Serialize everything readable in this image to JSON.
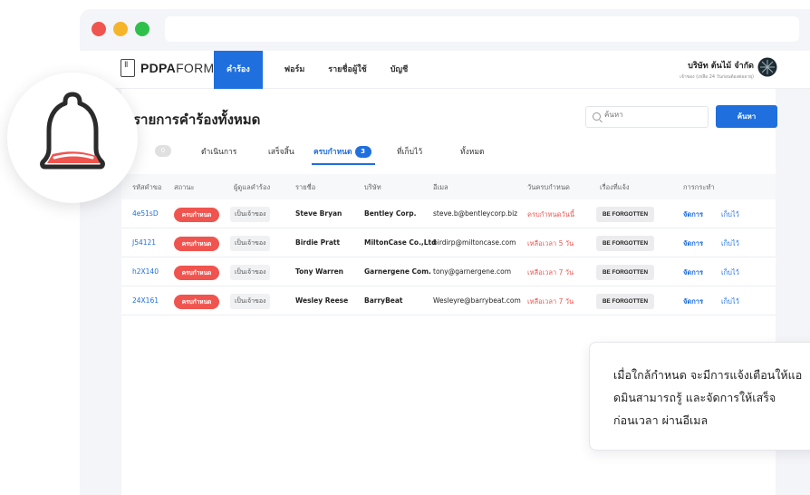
{
  "app": {
    "logo": {
      "strong": "PDPA",
      "light": "FORM"
    },
    "nav": [
      {
        "label": "คำร้อง",
        "active": true
      },
      {
        "label": "ฟอร์ม",
        "active": false
      },
      {
        "label": "รายชื่อผู้ใช้",
        "active": false
      },
      {
        "label": "บัญชี",
        "active": false
      }
    ],
    "company": {
      "name": "บริษัท ต้นไม้ จำกัด",
      "sub": "เจ้าของ (เหลือ 24 วันก่อนต้องต่ออายุ)"
    }
  },
  "page": {
    "title": "รายการคำร้องทั้งหมด",
    "search": {
      "placeholder": "ค้นหา",
      "button": "ค้นหา"
    }
  },
  "tabs": [
    {
      "label": "",
      "count": "0"
    },
    {
      "label": "ดำเนินการ",
      "count": ""
    },
    {
      "label": "เสร็จสิ้น",
      "count": ""
    },
    {
      "label": "ครบกำหนด",
      "count": "3"
    },
    {
      "label": "ที่เก็บไว้",
      "count": ""
    },
    {
      "label": "ทั้งหมด",
      "count": ""
    }
  ],
  "table": {
    "headers": [
      "รหัสคำขอ",
      "สถานะ",
      "ผู้ดูแลคำร้อง",
      "รายชื่อ",
      "บริษัท",
      "อีเมล",
      "วันครบกำหนด",
      "เรื่องที่แจ้ง",
      "การกระทำ"
    ],
    "rows": [
      {
        "code": "4e51sD",
        "status": "ครบกำหนด",
        "owner": "เป็นเจ้าของ",
        "name": "Steve Bryan",
        "company": "Bentley Corp.",
        "email": "steve.b@bentleycorp.biz",
        "due": "ครบกำหนดวันนี้",
        "subject": "BE FORGOTTEN",
        "manage": "จัดการ",
        "archive": "เก็บไว้"
      },
      {
        "code": "J54121",
        "status": "ครบกำหนด",
        "owner": "เป็นเจ้าของ",
        "name": "Birdie Pratt",
        "company": "MiltonCase Co.,Ltd",
        "email": "birdirp@miltoncase.com",
        "due": "เหลือเวลา 5 วัน",
        "subject": "BE FORGOTTEN",
        "manage": "จัดการ",
        "archive": "เก็บไว้"
      },
      {
        "code": "h2X140",
        "status": "ครบกำหนด",
        "owner": "เป็นเจ้าของ",
        "name": "Tony Warren",
        "company": "Garnergene Com.",
        "email": "tony@garnergene.com",
        "due": "เหลือเวลา 7 วัน",
        "subject": "BE FORGOTTEN",
        "manage": "จัดการ",
        "archive": "เก็บไว้"
      },
      {
        "code": "24X161",
        "status": "ครบกำหนด",
        "owner": "เป็นเจ้าของ",
        "name": "Wesley Reese",
        "company": "BarryBeat",
        "email": "Wesleyre@barrybeat.com",
        "due": "เหลือเวลา 7 วัน",
        "subject": "BE FORGOTTEN",
        "manage": "จัดการ",
        "archive": "เก็บไว้"
      }
    ]
  },
  "callout": {
    "lines": [
      "เมื่อใกล้กำหนด จะมีการแจ้งเตือนให้แอ",
      "ดมินสามารถรู้ และจัดการให้เสร็จ",
      "ก่อนเวลา ผ่านอีเมล"
    ]
  },
  "icons": {
    "bell": "bell-icon",
    "search": "search-icon",
    "avatar": "tree-logo-icon"
  },
  "colors": {
    "primary": "#1f6fde",
    "danger": "#f0544f",
    "bell_body": "#ffffff",
    "bell_stroke": "#2b2b2b",
    "bell_fill": "#f0544f"
  }
}
